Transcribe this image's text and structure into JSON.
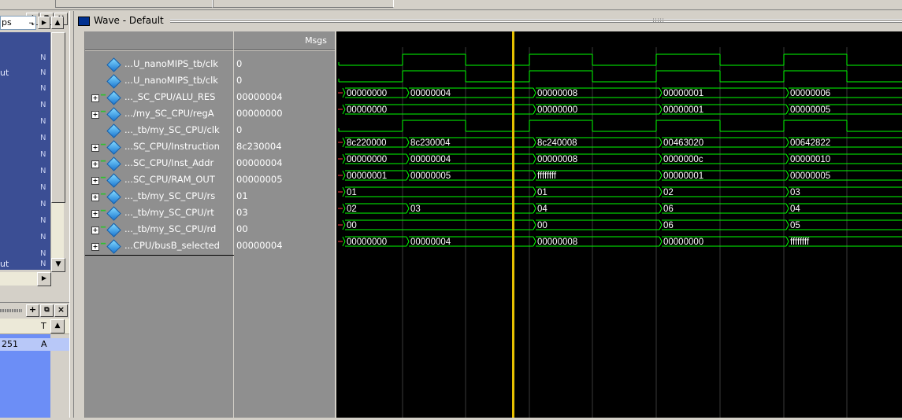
{
  "left_panel_top": {
    "combo_value": "ps",
    "list_items": [
      {
        "label": "",
        "suffix": "N"
      },
      {
        "label": "ut",
        "suffix": "N"
      },
      {
        "label": "",
        "suffix": "N"
      },
      {
        "label": "",
        "suffix": "N"
      },
      {
        "label": "",
        "suffix": "N"
      },
      {
        "label": "",
        "suffix": "N"
      },
      {
        "label": "",
        "suffix": "N"
      },
      {
        "label": "",
        "suffix": "N"
      },
      {
        "label": "",
        "suffix": "N"
      },
      {
        "label": "",
        "suffix": "N"
      },
      {
        "label": "",
        "suffix": "N"
      },
      {
        "label": "",
        "suffix": "N"
      },
      {
        "label": "",
        "suffix": "N"
      },
      {
        "label": "",
        "suffix": "N"
      },
      {
        "label": "",
        "suffix": "N"
      },
      {
        "label": "",
        "suffix": "N"
      },
      {
        "label": "",
        "suffix": "N"
      },
      {
        "label": "ut",
        "suffix": "N"
      }
    ]
  },
  "left_panel_bottom": {
    "column_header": "T",
    "row_value": "251",
    "row_suffix": "A"
  },
  "wave_window": {
    "title": "Wave - Default",
    "msgs_header": "Msgs",
    "signals": [
      {
        "name": "...U_nanoMIPS_tb/clk",
        "value": "0",
        "expandable": false
      },
      {
        "name": "...U_nanoMIPS_tb/clk",
        "value": "0",
        "expandable": false
      },
      {
        "name": "..._SC_CPU/ALU_RES",
        "value": "00000004",
        "expandable": true
      },
      {
        "name": ".../my_SC_CPU/regA",
        "value": "00000000",
        "expandable": true
      },
      {
        "name": "..._tb/my_SC_CPU/clk",
        "value": "0",
        "expandable": false
      },
      {
        "name": "...SC_CPU/Instruction",
        "value": "8c230004",
        "expandable": true
      },
      {
        "name": "...SC_CPU/Inst_Addr",
        "value": "00000004",
        "expandable": true
      },
      {
        "name": "...SC_CPU/RAM_OUT",
        "value": "00000005",
        "expandable": true
      },
      {
        "name": "..._tb/my_SC_CPU/rs",
        "value": "01",
        "expandable": true
      },
      {
        "name": "..._tb/my_SC_CPU/rt",
        "value": "03",
        "expandable": true
      },
      {
        "name": "..._tb/my_SC_CPU/rd",
        "value": "00",
        "expandable": true
      },
      {
        "name": "...CPU/busB_selected",
        "value": "00000004",
        "expandable": true
      }
    ],
    "bus_waves": [
      {
        "row": 2,
        "segments": [
          "00000000",
          "00000004",
          "00000008",
          "00000001",
          "00000006"
        ]
      },
      {
        "row": 3,
        "segments": [
          "00000000",
          "00000000",
          "00000001",
          "00000005"
        ]
      },
      {
        "row": 5,
        "segments": [
          "8c220000",
          "8c230004",
          "8c240008",
          "00463020",
          "00642822"
        ]
      },
      {
        "row": 6,
        "segments": [
          "00000000",
          "00000004",
          "00000008",
          "0000000c",
          "00000010"
        ]
      },
      {
        "row": 7,
        "segments": [
          "00000001",
          "00000005",
          "ffffffff",
          "00000001",
          "00000005"
        ]
      },
      {
        "row": 8,
        "segments": [
          "01",
          "01",
          "02",
          "03"
        ]
      },
      {
        "row": 9,
        "segments": [
          "02",
          "03",
          "04",
          "06",
          "04"
        ]
      },
      {
        "row": 10,
        "segments": [
          "00",
          "00",
          "06",
          "05"
        ]
      },
      {
        "row": 11,
        "segments": [
          "00000000",
          "00000004",
          "00000008",
          "00000000",
          "ffffffff"
        ]
      }
    ],
    "colors": {
      "wave": "#00ff00",
      "cursor": "#e6c000",
      "background": "#000000",
      "transition": "#ff4040"
    }
  }
}
